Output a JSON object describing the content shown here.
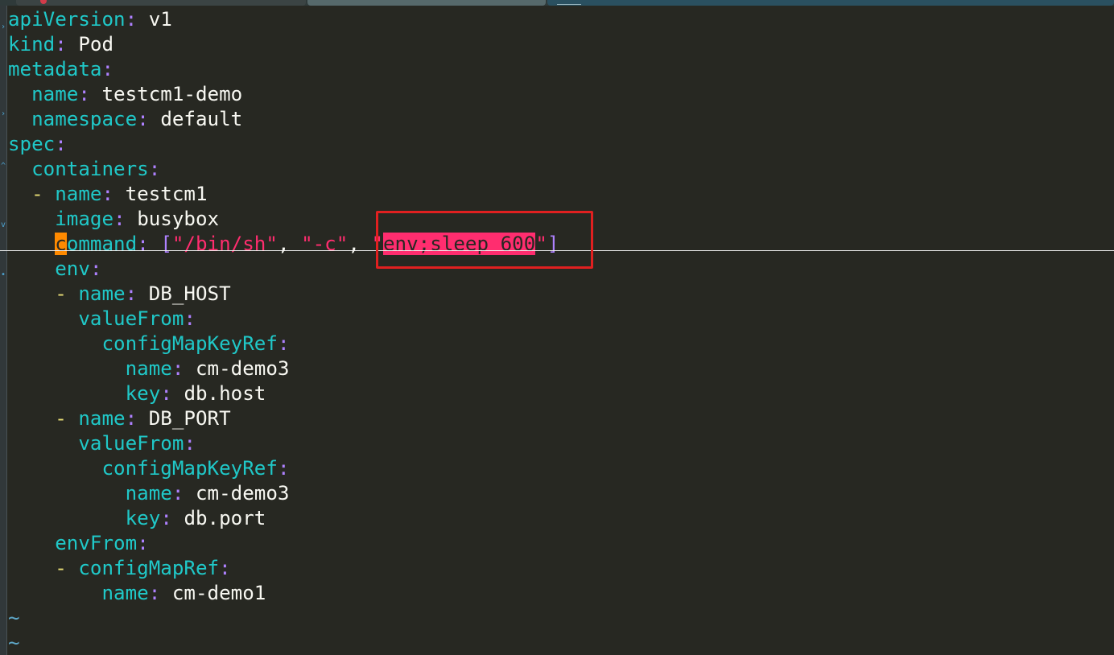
{
  "editor": {
    "lines": [
      {
        "indent": "",
        "dash": "",
        "key": "apiVersion",
        "value": "v1"
      },
      {
        "indent": "",
        "dash": "",
        "key": "kind",
        "value": "Pod"
      },
      {
        "indent": "",
        "dash": "",
        "key": "metadata",
        "value": ""
      },
      {
        "indent": "  ",
        "dash": "",
        "key": "name",
        "value": "testcm1-demo"
      },
      {
        "indent": "  ",
        "dash": "",
        "key": "namespace",
        "value": "default"
      },
      {
        "indent": "",
        "dash": "",
        "key": "spec",
        "value": ""
      },
      {
        "indent": "  ",
        "dash": "",
        "key": "containers",
        "value": ""
      },
      {
        "indent": "  ",
        "dash": "- ",
        "key": "name",
        "value": "testcm1"
      },
      {
        "indent": "    ",
        "dash": "",
        "key": "image",
        "value": "busybox"
      },
      {
        "special": "command"
      },
      {
        "indent": "    ",
        "dash": "",
        "key": "env",
        "value": ""
      },
      {
        "indent": "    ",
        "dash": "- ",
        "key": "name",
        "value": "DB_HOST"
      },
      {
        "indent": "      ",
        "dash": "",
        "key": "valueFrom",
        "value": ""
      },
      {
        "indent": "        ",
        "dash": "",
        "key": "configMapKeyRef",
        "value": ""
      },
      {
        "indent": "          ",
        "dash": "",
        "key": "name",
        "value": "cm-demo3"
      },
      {
        "indent": "          ",
        "dash": "",
        "key": "key",
        "value": "db.host"
      },
      {
        "indent": "    ",
        "dash": "- ",
        "key": "name",
        "value": "DB_PORT"
      },
      {
        "indent": "      ",
        "dash": "",
        "key": "valueFrom",
        "value": ""
      },
      {
        "indent": "        ",
        "dash": "",
        "key": "configMapKeyRef",
        "value": ""
      },
      {
        "indent": "          ",
        "dash": "",
        "key": "name",
        "value": "cm-demo3"
      },
      {
        "indent": "          ",
        "dash": "",
        "key": "key",
        "value": "db.port"
      },
      {
        "indent": "    ",
        "dash": "",
        "key": "envFrom",
        "value": ""
      },
      {
        "indent": "    ",
        "dash": "- ",
        "key": "configMapRef",
        "value": ""
      },
      {
        "indent": "        ",
        "dash": "",
        "key": "name",
        "value": "cm-demo1"
      }
    ],
    "command_line": {
      "indent": "    ",
      "cursor_char": "c",
      "key_rest": "ommand",
      "colon": ":",
      "open_bracket": "[",
      "arg1": "\"/bin/sh\"",
      "sep1": ", ",
      "arg2": "\"-c\"",
      "sep2": ", ",
      "arg3_open_quote": "\"",
      "arg3_highlight": "env;sleep 600",
      "arg3_close_quote": "\"",
      "close_bracket": "]"
    },
    "empty_line_marker": "~",
    "empty_line_count": 2
  },
  "colors": {
    "background": "#272822",
    "key": "#20c8c8",
    "colon": "#ae81ff",
    "string": "#ff2d6f",
    "text": "#f8f8f2",
    "cursor": "#ff8a00",
    "annotation": "#e02020"
  }
}
